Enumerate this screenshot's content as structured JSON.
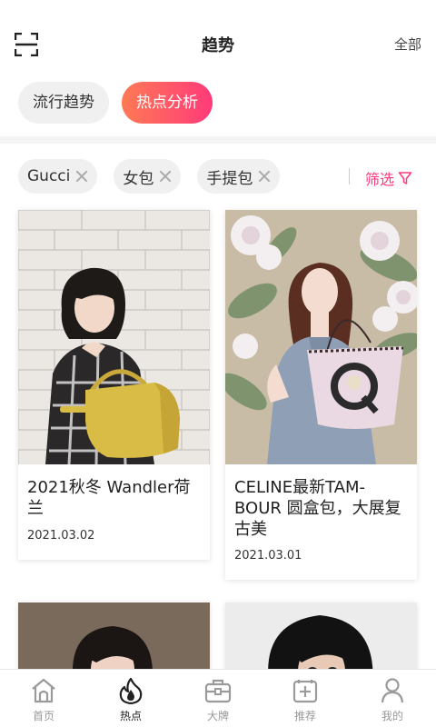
{
  "header": {
    "title": "趋势",
    "all_label": "全部"
  },
  "tabs": [
    {
      "label": "流行趋势",
      "active": false
    },
    {
      "label": "热点分析",
      "active": true
    }
  ],
  "filters": {
    "chips": [
      {
        "label": "Gucci"
      },
      {
        "label": "女包"
      },
      {
        "label": "手提包"
      }
    ],
    "filter_label": "筛选"
  },
  "cards": [
    {
      "title": "2021秋冬 Wandler荷兰",
      "date": "2021.03.02"
    },
    {
      "title": "CELINE最新TAM-BOUR 圆盒包，大展复古美",
      "date": "2021.03.01"
    },
    {
      "title": "",
      "date": ""
    },
    {
      "title": "",
      "date": ""
    }
  ],
  "bottom_nav": [
    {
      "label": "首页",
      "icon": "home-icon",
      "active": false
    },
    {
      "label": "热点",
      "icon": "flame-icon",
      "active": true
    },
    {
      "label": "大牌",
      "icon": "briefcase-icon",
      "active": false
    },
    {
      "label": "推荐",
      "icon": "recommend-icon",
      "active": false
    },
    {
      "label": "我的",
      "icon": "user-icon",
      "active": false
    }
  ],
  "colors": {
    "accent": "#ff3a7a",
    "accent_start": "#ff7a55"
  }
}
